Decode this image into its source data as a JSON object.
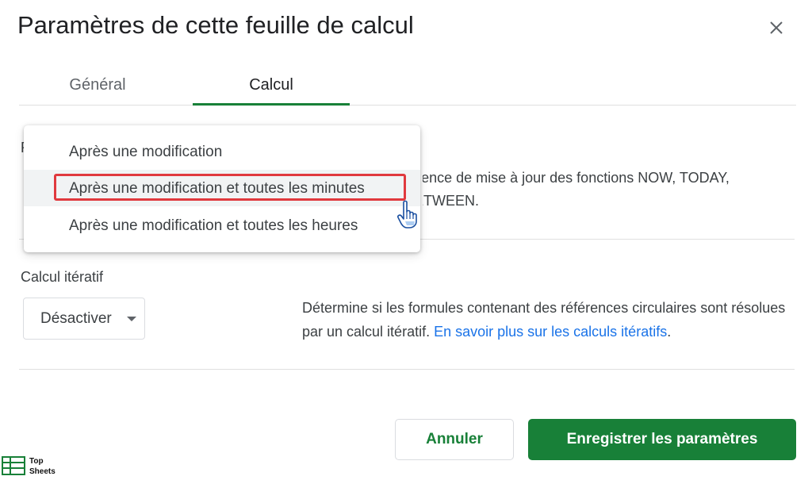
{
  "dialog": {
    "title": "Paramètres de cette feuille de calcul",
    "close_icon": "close-icon"
  },
  "tabs": [
    {
      "label": "Général",
      "active": false
    },
    {
      "label": "Calcul",
      "active": true
    }
  ],
  "recalc": {
    "label_initial": "R",
    "description_line1": "Détermine la fréquence de mise à jour des fonctions NOW, TODAY,",
    "description_line2": "RAND et RANDBETWEEN."
  },
  "dropdown_menu": {
    "options": [
      "Après une modification",
      "Après une modification et toutes les minutes",
      "Après une modification et toutes les heures"
    ],
    "hovered_index": 1
  },
  "iterative": {
    "label": "Calcul itératif",
    "selected": "Désactiver",
    "description": "Détermine si les formules contenant des références circulaires sont résolues par un calcul itératif.",
    "link_text": "En savoir plus sur les calculs itératifs",
    "period": "."
  },
  "buttons": {
    "cancel": "Annuler",
    "save": "Enregistrer les paramètres"
  },
  "watermark": {
    "line1": "Top",
    "line2": "Sheets"
  },
  "colors": {
    "accent_green": "#188038",
    "link_blue": "#1a73e8",
    "highlight_red": "#e0393e"
  }
}
